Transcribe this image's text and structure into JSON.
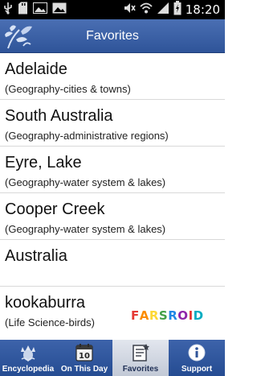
{
  "status_bar": {
    "time": "18:20",
    "icons": [
      "usb-icon",
      "sd-card-icon",
      "image-icon",
      "photo-icon",
      "mute-icon",
      "wifi-icon",
      "signal-icon",
      "battery-charging-icon"
    ]
  },
  "app_bar": {
    "title": "Favorites",
    "logo_icon": "thistle-logo-icon"
  },
  "favorites": [
    {
      "title": "Adelaide",
      "category": "(Geography-cities & towns)"
    },
    {
      "title": "South Australia",
      "category": "(Geography-administrative regions)"
    },
    {
      "title": "Eyre, Lake",
      "category": "(Geography-water system & lakes)"
    },
    {
      "title": "Cooper Creek",
      "category": "(Geography-water system & lakes)"
    },
    {
      "title": "Australia",
      "category": ""
    },
    {
      "title": "kookaburra",
      "category": "(Life Science-birds)"
    }
  ],
  "watermark": {
    "letters": [
      "F",
      "A",
      "R",
      "S",
      "R",
      "O",
      "I",
      "D"
    ],
    "colors": [
      "#e53935",
      "#fb8c00",
      "#fdd835",
      "#43a047",
      "#1e88e5",
      "#8e24aa",
      "#e53935",
      "#00acc1"
    ]
  },
  "tab_bar": {
    "tabs": [
      {
        "label": "Encyclopedia",
        "icon": "thistle-icon",
        "active": false
      },
      {
        "label": "On This Day",
        "icon": "calendar-icon",
        "day": "10",
        "active": false
      },
      {
        "label": "Favorites",
        "icon": "favorites-list-icon",
        "active": true
      },
      {
        "label": "Support",
        "icon": "info-icon",
        "active": false
      }
    ]
  },
  "colors": {
    "header_blue": "#2f5499",
    "tab_active": "#d5dae4"
  }
}
